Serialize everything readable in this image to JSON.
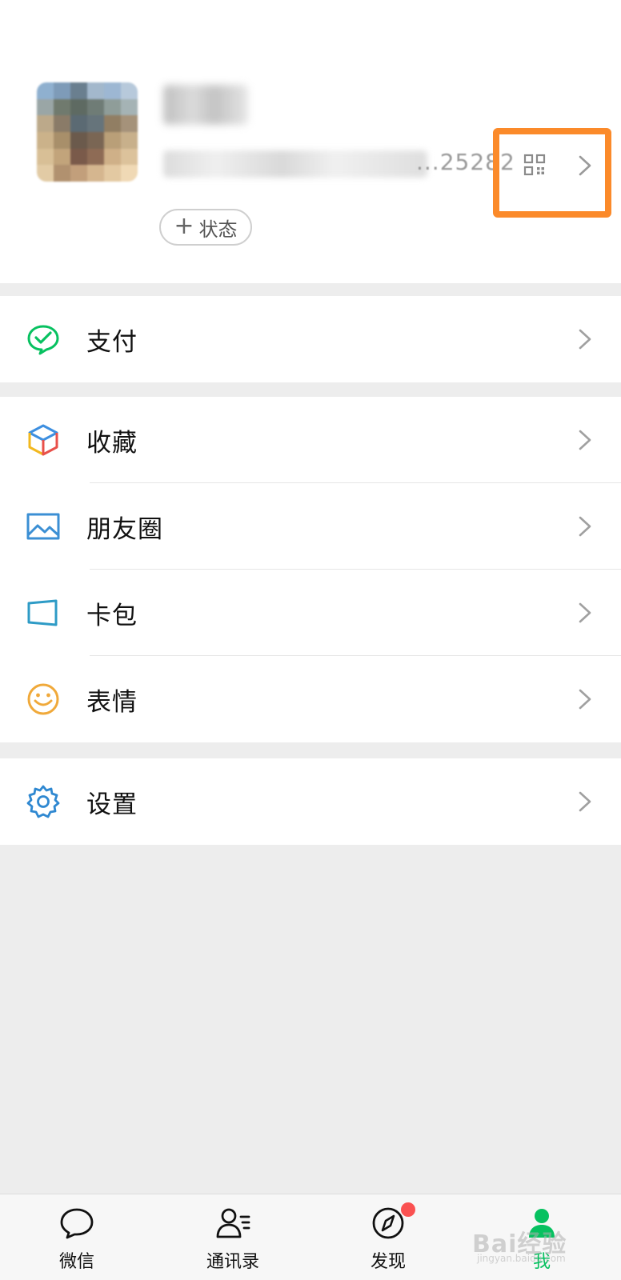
{
  "profile": {
    "wxid_visible_tail": "...25282",
    "status_label": "状态",
    "status_plus": "+"
  },
  "groups": [
    {
      "items": [
        {
          "label": "支付",
          "icon": "wechat-pay-icon"
        }
      ]
    },
    {
      "items": [
        {
          "label": "收藏",
          "icon": "favorites-cube-icon"
        },
        {
          "label": "朋友圈",
          "icon": "moments-picture-icon"
        },
        {
          "label": "卡包",
          "icon": "card-wallet-icon"
        },
        {
          "label": "表情",
          "icon": "sticker-smile-icon"
        }
      ]
    },
    {
      "items": [
        {
          "label": "设置",
          "icon": "settings-gear-icon"
        }
      ]
    }
  ],
  "tabbar": {
    "tabs": [
      {
        "label": "微信",
        "icon": "chat-bubble-icon"
      },
      {
        "label": "通讯录",
        "icon": "contacts-icon"
      },
      {
        "label": "发现",
        "icon": "compass-icon",
        "badge": "red-dot"
      },
      {
        "label": "我",
        "icon": "me-person-icon",
        "active": true
      }
    ]
  },
  "watermark": {
    "main": "Bai经验",
    "sub": "jingyan.baidu.com"
  },
  "colors": {
    "highlight_box": "#fb8a2a",
    "accent_green": "#07c160",
    "badge_red": "#fa5151",
    "page_bg": "#ededed"
  }
}
